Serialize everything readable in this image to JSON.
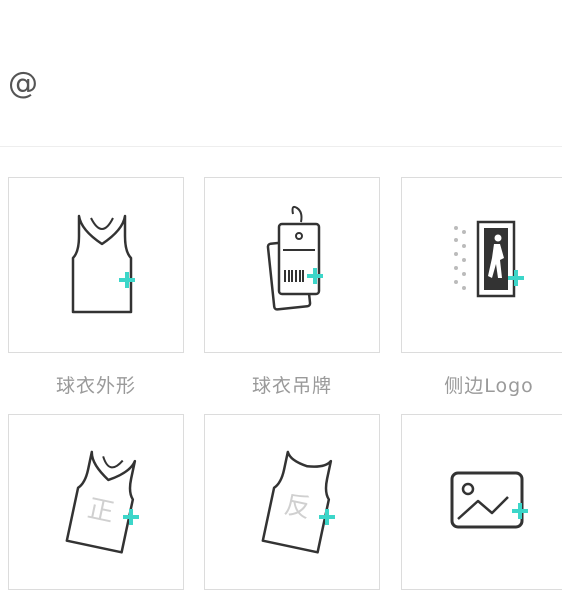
{
  "header": {
    "at_symbol": "@"
  },
  "colors": {
    "plus": "#3cd6c9",
    "icon_stroke": "#333333",
    "label": "#9a9a9a"
  },
  "options": [
    {
      "label": "球衣外形",
      "icon": "jersey-outline-icon"
    },
    {
      "label": "球衣吊牌",
      "icon": "jersey-tag-icon"
    },
    {
      "label": "侧边Logo",
      "icon": "side-logo-icon"
    },
    {
      "label": "",
      "icon": "jersey-front-number-icon",
      "jersey_glyph": "正"
    },
    {
      "label": "",
      "icon": "jersey-back-number-icon",
      "jersey_glyph": "反"
    },
    {
      "label": "",
      "icon": "image-upload-icon"
    }
  ]
}
